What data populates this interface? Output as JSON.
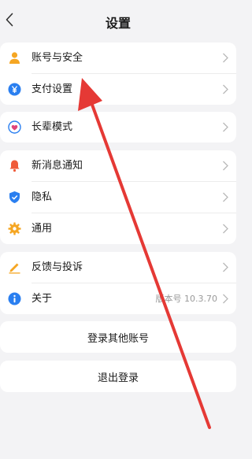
{
  "header": {
    "title": "设置"
  },
  "groups": [
    {
      "items": [
        {
          "label": "账号与安全",
          "icon": "person-icon"
        },
        {
          "label": "支付设置",
          "icon": "yen-icon"
        }
      ]
    },
    {
      "items": [
        {
          "label": "长辈模式",
          "icon": "heart-icon"
        }
      ]
    },
    {
      "items": [
        {
          "label": "新消息通知",
          "icon": "bell-icon"
        },
        {
          "label": "隐私",
          "icon": "shield-icon"
        },
        {
          "label": "通用",
          "icon": "gear-icon"
        }
      ]
    },
    {
      "items": [
        {
          "label": "反馈与投诉",
          "icon": "pencil-icon"
        },
        {
          "label": "关于",
          "icon": "info-icon",
          "value": "版本号 10.3.70"
        }
      ]
    }
  ],
  "actions": {
    "switch_account": "登录其他账号",
    "logout": "退出登录"
  },
  "colors": {
    "accent_blue": "#2a7ff0",
    "orange": "#f5a623",
    "red_arrow": "#e53935",
    "background": "#f3f3f5"
  }
}
